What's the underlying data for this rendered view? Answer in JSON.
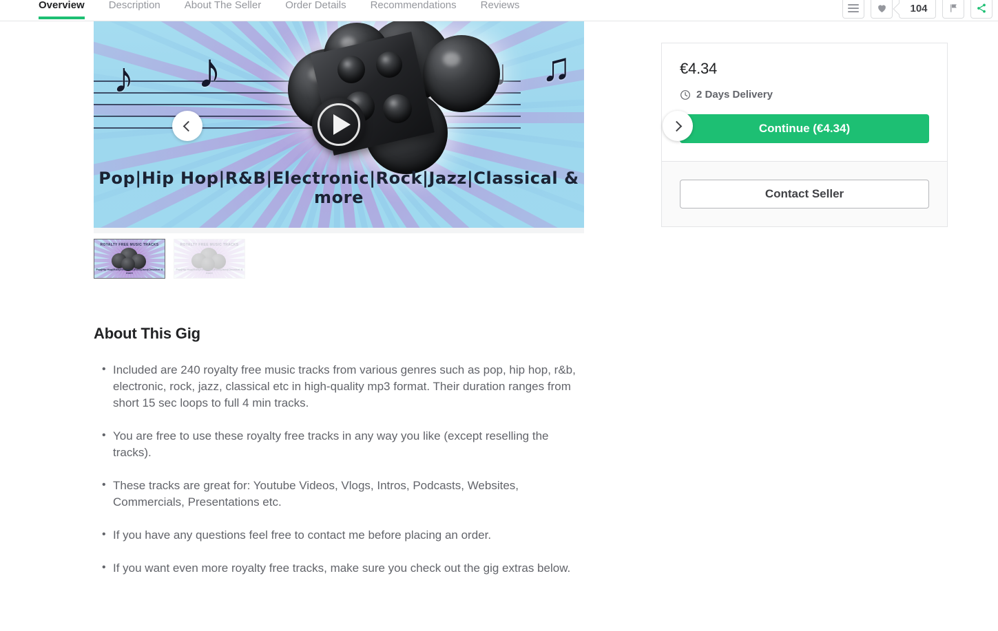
{
  "tabs": [
    {
      "label": "Overview",
      "active": true
    },
    {
      "label": "Description",
      "active": false
    },
    {
      "label": "About The Seller",
      "active": false
    },
    {
      "label": "Order Details",
      "active": false
    },
    {
      "label": "Recommendations",
      "active": false
    },
    {
      "label": "Reviews",
      "active": false
    }
  ],
  "top_actions": {
    "menu_icon": "hamburger-icon",
    "favorite_icon": "heart-icon",
    "favorite_count": "104",
    "report_icon": "flag-icon",
    "share_icon": "share-icon"
  },
  "gallery": {
    "prev_icon": "chevron-left-icon",
    "next_icon": "chevron-right-icon",
    "play_icon": "play-icon",
    "hero_caption": "Pop|Hip Hop|R&B|Electronic|Rock|Jazz|Classical & more",
    "thumbnails": [
      {
        "title": "ROYALTY FREE MUSIC TRACKS",
        "caption": "Pop|Hip Hop|R&B|Electronic|Rock|Jazz|Classical & more",
        "active": true
      },
      {
        "title": "ROYALTY FREE MUSIC TRACKS",
        "caption": "Pop|Hip Hop|R&B|Electronic|Rock|Jazz|Classical & more",
        "active": false
      }
    ]
  },
  "about": {
    "heading": "About This Gig",
    "bullets": [
      "Included are 240 royalty free music tracks from various genres such as pop, hip hop, r&b, electronic, rock, jazz, classical etc  in high-quality mp3 format. Their duration ranges from short 15 sec loops to full 4 min tracks.",
      "You are free to use these royalty free tracks in any way you like (except reselling the tracks).",
      "These tracks are great for: Youtube Videos, Vlogs, Intros, Podcasts, Websites, Commercials, Presentations etc.",
      "If you have any questions feel free to contact me before placing an order.",
      "If you want even more royalty free tracks, make sure you check out the gig extras below."
    ]
  },
  "order_panel": {
    "price": "€4.34",
    "delivery_icon": "clock-icon",
    "delivery": "2 Days Delivery",
    "continue_label": "Continue (€4.34)",
    "contact_label": "Contact Seller"
  },
  "colors": {
    "brand_green": "#1dbf73",
    "text_dark": "#222325",
    "text_muted": "#62646a",
    "border": "#e4e5e7"
  }
}
